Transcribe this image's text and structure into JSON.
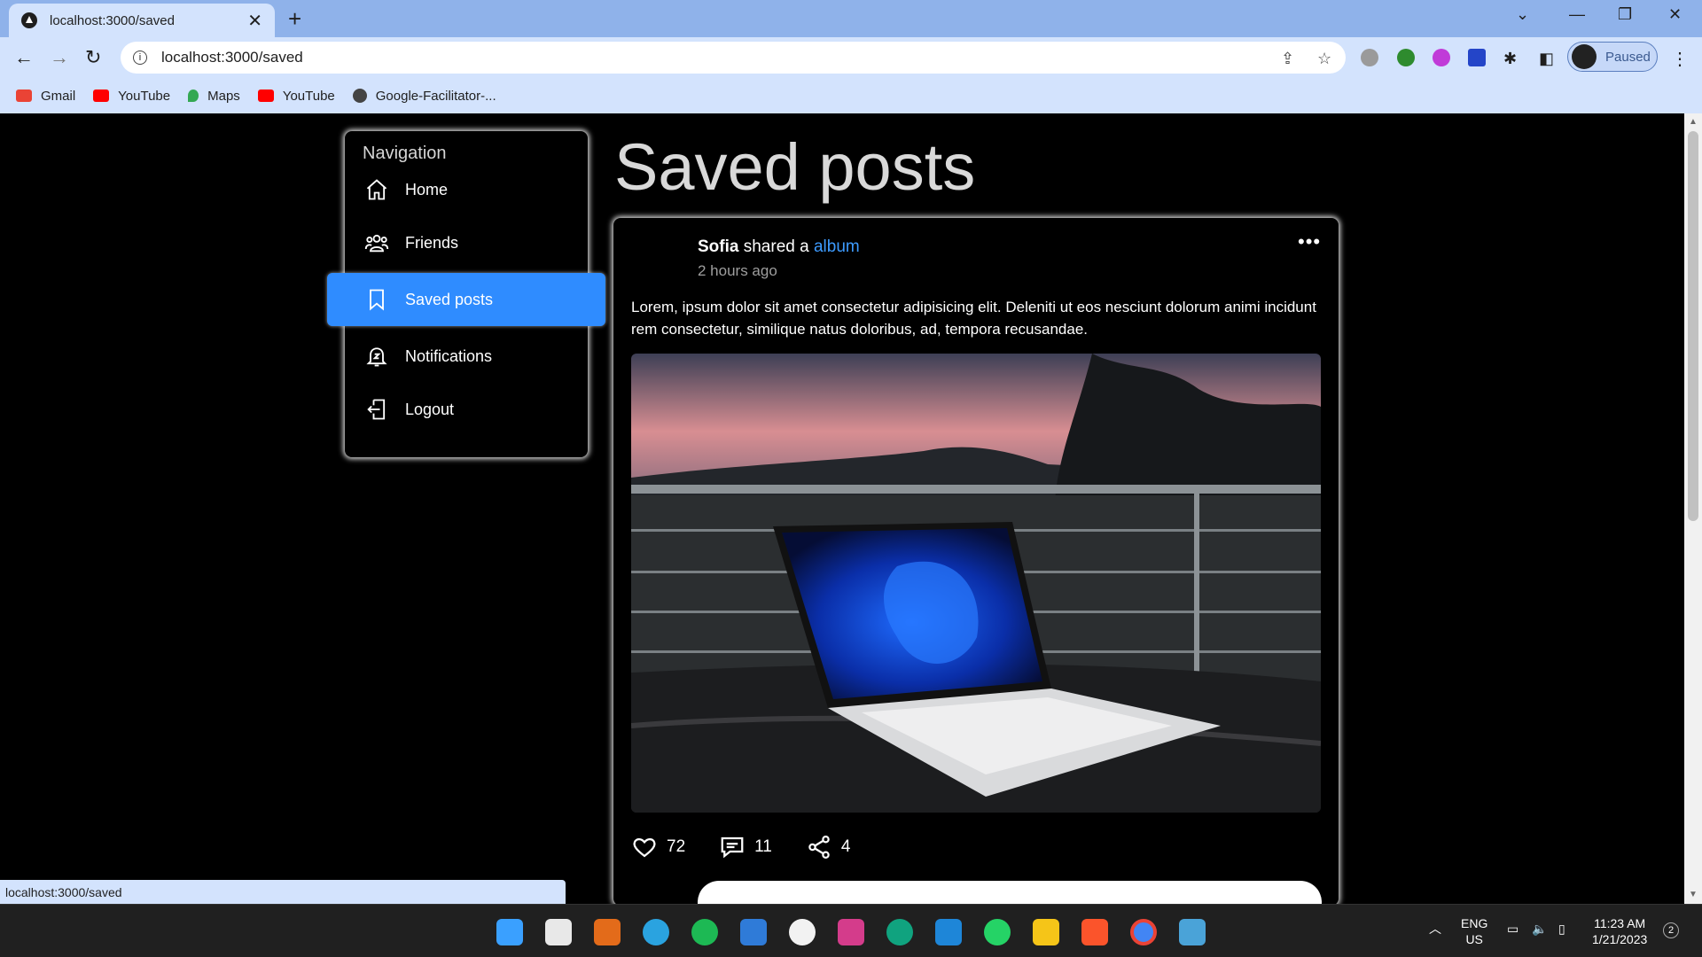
{
  "browser": {
    "tab_title": "localhost:3000/saved",
    "url": "localhost:3000/saved",
    "profile_label": "Paused",
    "bookmarks": [
      {
        "label": "Gmail",
        "color": "#ea4335"
      },
      {
        "label": "YouTube",
        "color": "#ff0000"
      },
      {
        "label": "Maps",
        "color": "#34a853"
      },
      {
        "label": "YouTube",
        "color": "#ff0000"
      },
      {
        "label": "Google-Facilitator-...",
        "color": "#444444"
      }
    ]
  },
  "sidebar": {
    "title": "Navigation",
    "items": [
      {
        "label": "Home",
        "icon": "home-icon"
      },
      {
        "label": "Friends",
        "icon": "friends-icon"
      },
      {
        "label": "Saved posts",
        "icon": "bookmark-icon",
        "active": true
      },
      {
        "label": "Notifications",
        "icon": "bell-icon"
      },
      {
        "label": "Logout",
        "icon": "logout-icon"
      }
    ]
  },
  "main": {
    "title": "Saved posts",
    "post": {
      "author": "Sofia",
      "action": "shared a",
      "link": "album",
      "time": "2 hours ago",
      "text": "Lorem, ipsum dolor sit amet consectetur adipisicing elit. Deleniti ut eos nesciunt dolorum animi incidunt rem consectetur, similique natus doloribus, ad, tempora recusandae.",
      "likes": "72",
      "comments": "11",
      "shares": "4"
    }
  },
  "status_url": "localhost:3000/saved",
  "taskbar": {
    "lang_line1": "ENG",
    "lang_line2": "US",
    "time": "11:23 AM",
    "date": "1/21/2023",
    "notif_count": "2"
  },
  "colors": {
    "accent": "#2f8cff",
    "link": "#3d9bff"
  }
}
